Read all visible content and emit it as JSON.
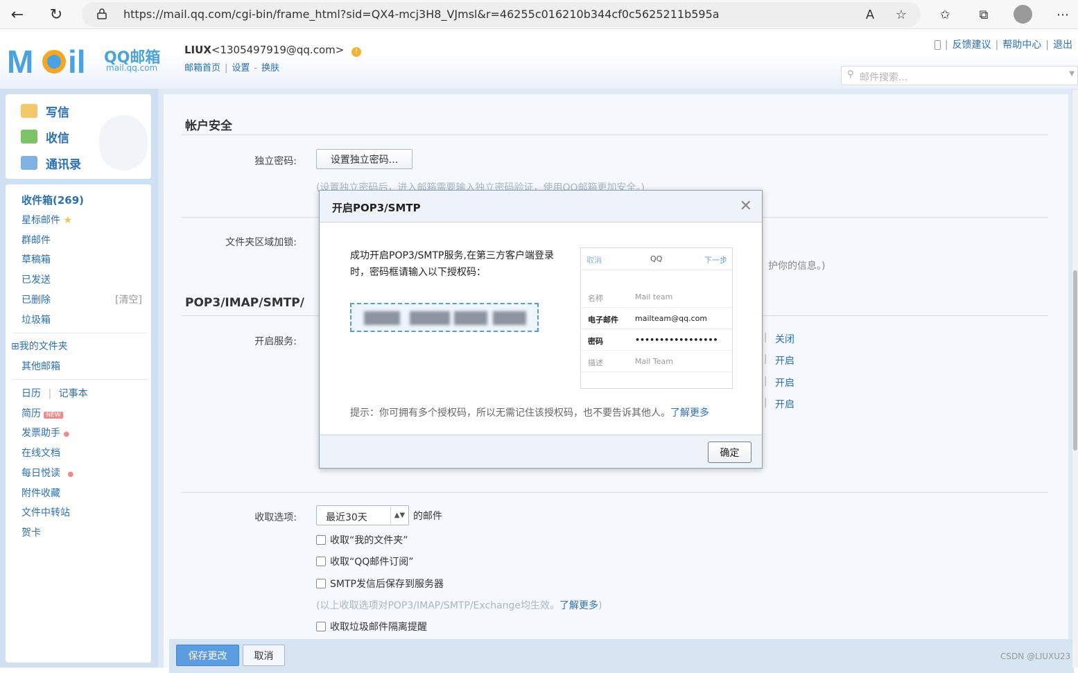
{
  "browser": {
    "url": "https://mail.qq.com/cgi-bin/frame_html?sid=QX4-mcj3H8_VJmsl&r=46255c016210b344cf0c5625211b595a"
  },
  "header": {
    "logo_text": "QQ邮箱",
    "logo_sub": "mail.qq.com",
    "user_name": "LIUX",
    "user_email": "<1305497919@qq.com>",
    "links": [
      "邮箱首页",
      "|",
      "设置",
      "-",
      "换肤"
    ],
    "top_links": [
      "反馈建议",
      "帮助中心",
      "退出"
    ],
    "search_placeholder": "邮件搜索..."
  },
  "sidebar": {
    "actions": [
      "写信",
      "收信",
      "通讯录"
    ],
    "folders": [
      {
        "label": "收件箱(269)"
      },
      {
        "label": "星标邮件"
      },
      {
        "label": "群邮件"
      },
      {
        "label": "草稿箱"
      },
      {
        "label": "已发送"
      },
      {
        "label": "已删除",
        "extra": "[清空]"
      },
      {
        "label": "垃圾箱"
      }
    ],
    "my_folders": "⊞我的文件夹",
    "other_mailbox": "其他邮箱",
    "tools": [
      "日历",
      "|",
      "记事本"
    ],
    "apps": [
      "简历",
      "发票助手",
      "在线文档",
      "每日悦读",
      "附件收藏",
      "文件中转站",
      "贺卡"
    ],
    "new_badge": "NEW"
  },
  "settings": {
    "account_security_title": "帐户安全",
    "independent_password_label": "独立密码:",
    "independent_password_button": "设置独立密码...",
    "independent_password_note": "(设置独立密码后，进入邮箱需要输入独立密码验证，使用QQ邮箱更加安全。)",
    "folder_lock_label": "文件夹区域加锁:",
    "folder_lock_note_tail": "护你的信息。)",
    "pop_title": "POP3/IMAP/SMTP/",
    "service_label": "开启服务:",
    "service_status": [
      "关闭",
      "开启",
      "开启",
      "开启"
    ],
    "service_sep": "|",
    "receive_label": "收取选项:",
    "receive_select": "最近30天",
    "receive_suffix": "的邮件",
    "options": [
      "收取“我的文件夹”",
      "收取“QQ邮件订阅”",
      "SMTP发信后保存到服务器"
    ],
    "options_note": "(以上收取选项对POP3/IMAP/SMTP/Exchange均生效。",
    "options_note_link": "了解更多",
    "options_note_end": ")",
    "spam_option": "收取垃圾邮件隔离提醒",
    "save_button": "保存更改",
    "cancel_button": "取消"
  },
  "dialog": {
    "title": "开启POP3/SMTP",
    "message": "成功开启POP3/SMTP服务,在第三方客户端登录时，密码框请输入以下授权码：",
    "phone": {
      "cancel": "取消",
      "title": "QQ",
      "next": "下一步",
      "rows": [
        {
          "k": "名称",
          "v": "Mail team"
        },
        {
          "k": "电子邮件",
          "v": "mailteam@qq.com"
        },
        {
          "k": "密码",
          "v": "•••••••••••••••••"
        },
        {
          "k": "描述",
          "v": "Mail Team"
        }
      ]
    },
    "tip": "提示：你可拥有多个授权码，所以无需记住该授权码，也不要告诉其他人。",
    "tip_link": "了解更多",
    "ok_button": "确定"
  },
  "watermark": "CSDN @LIUXU23",
  "colors": {
    "accent": "#2c6fb5",
    "frame": "#cfe0f3",
    "primary_button": "#5b9be0"
  }
}
